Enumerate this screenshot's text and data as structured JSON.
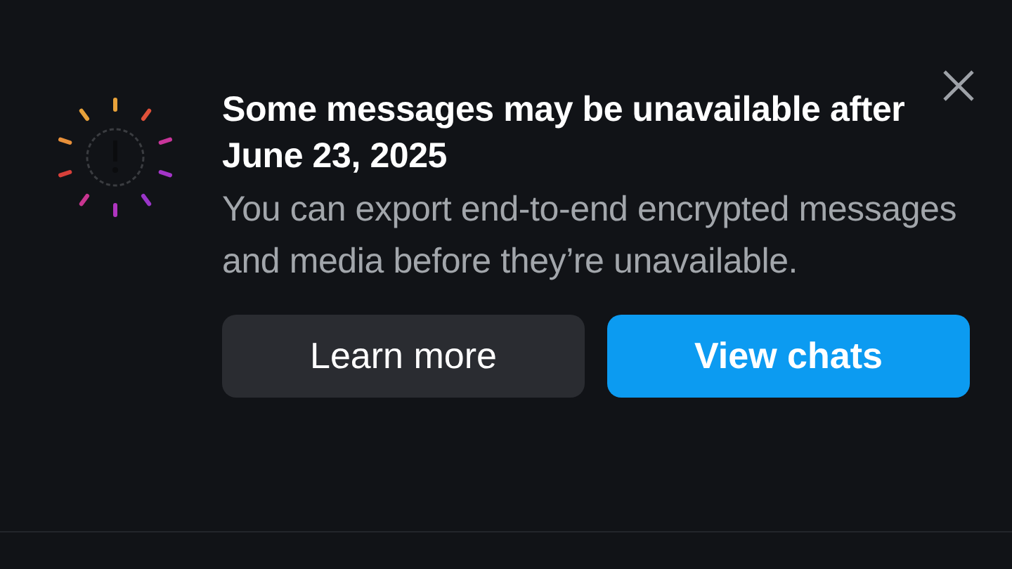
{
  "title": "Some messages may be unavailable after June 23, 2025",
  "body": "You can export end-to-end encrypted messages and media before they’re unavailable.",
  "buttons": [
    {
      "label": "Learn more",
      "kind": "secondary"
    },
    {
      "label": "View chats",
      "kind": "primary"
    }
  ]
}
